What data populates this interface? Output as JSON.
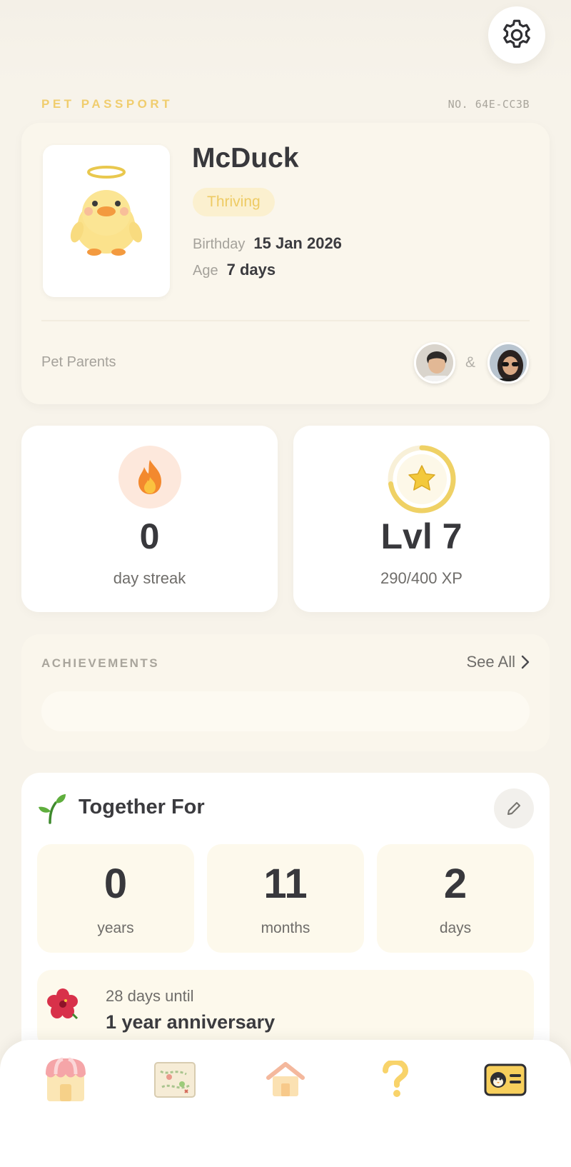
{
  "passport": {
    "title": "PET PASSPORT",
    "number": "NO. 64E-CC3B"
  },
  "pet": {
    "name": "McDuck",
    "status": "Thriving",
    "birthday_label": "Birthday",
    "birthday_value": "15 Jan 2026",
    "age_label": "Age",
    "age_value": "7 days",
    "parents_label": "Pet Parents",
    "parents_separator": "&"
  },
  "stats": {
    "streak_value": "0",
    "streak_label": "day streak",
    "level_value": "Lvl 7",
    "xp_label": "290/400 XP",
    "xp_progress": 0.725
  },
  "achievements": {
    "title": "ACHIEVEMENTS",
    "see_all": "See All"
  },
  "together": {
    "title": "Together For",
    "years_value": "0",
    "years_label": "years",
    "months_value": "11",
    "months_label": "months",
    "days_value": "2",
    "days_label": "days",
    "countdown": "28 days until",
    "milestone": "1 year anniversary"
  },
  "nav": {
    "items": [
      "shop-icon",
      "map-icon",
      "home-icon",
      "help-icon",
      "passport-icon"
    ],
    "active": "passport-icon"
  },
  "colors": {
    "background": "#f7f3ea",
    "accent_yellow": "#f0cd6e",
    "flame_bg": "#fde8dc",
    "text_dark": "#38383c"
  }
}
